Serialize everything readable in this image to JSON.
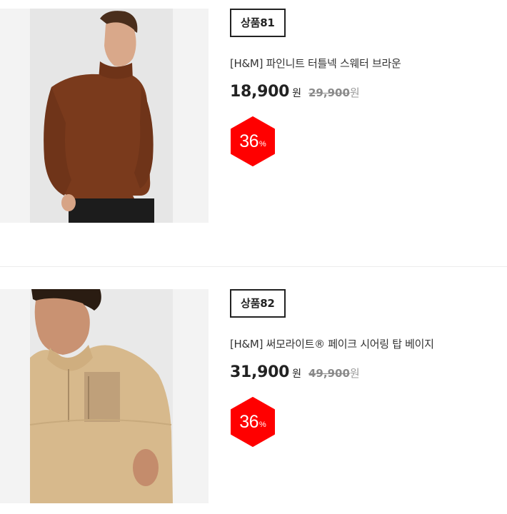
{
  "products": [
    {
      "label": "상품81",
      "title": "[H&M] 파인니트 터틀넥 스웨터 브라운",
      "price": "18,900",
      "price_unit": "원",
      "original_price": "29,900",
      "original_unit": "원",
      "discount": "36",
      "discount_unit": "%"
    },
    {
      "label": "상품82",
      "title": "[H&M] 써모라이트® 페이크 시어링 탑 베이지",
      "price": "31,900",
      "price_unit": "원",
      "original_price": "49,900",
      "original_unit": "원",
      "discount": "36",
      "discount_unit": "%"
    }
  ],
  "colors": {
    "discount_badge": "#ff0000",
    "sweater_brown": "#7a3a1c",
    "fleece_beige": "#d7b98c"
  },
  "icons": [
    "turtleneck-sweater-photo",
    "fleece-pullover-photo",
    "hexagon-discount-icon"
  ]
}
